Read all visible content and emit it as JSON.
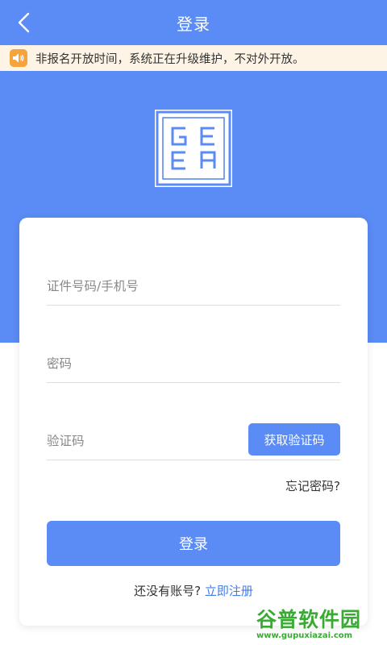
{
  "header": {
    "title": "登录"
  },
  "notice": {
    "text": "非报名开放时间，系统正在升级维护，不对外开放。"
  },
  "logo": {
    "text": "GEEA"
  },
  "form": {
    "account_placeholder": "证件号码/手机号",
    "password_placeholder": "密码",
    "code_placeholder": "验证码",
    "get_code_label": "获取验证码",
    "forgot_label": "忘记密码?",
    "login_label": "登录",
    "no_account_text": "还没有账号?",
    "register_label": "立即注册"
  },
  "watermark": {
    "main": "谷普软件园",
    "sub": "www.gupuxiazai.com"
  },
  "colors": {
    "primary": "#5b8bf4",
    "notice_bg": "#fdf4e6",
    "notice_icon": "#f5a33a",
    "link": "#3f7cf2"
  }
}
